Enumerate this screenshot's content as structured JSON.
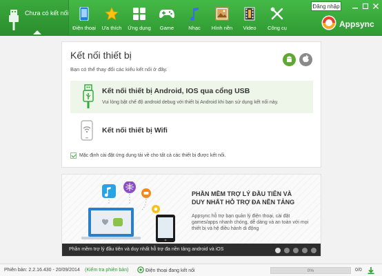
{
  "device": {
    "status_label": "Chưa có kết nối"
  },
  "nav": [
    {
      "label": "Điện thoại",
      "icon": "phone-icon"
    },
    {
      "label": "Ưa thích",
      "icon": "star-icon"
    },
    {
      "label": "Ứng dụng",
      "icon": "apps-grid-icon"
    },
    {
      "label": "Game",
      "icon": "gamepad-icon"
    },
    {
      "label": "Nhạc",
      "icon": "music-note-icon"
    },
    {
      "label": "Hình nền",
      "icon": "wallpaper-icon"
    },
    {
      "label": "Video",
      "icon": "film-icon"
    },
    {
      "label": "Công cụ",
      "icon": "tools-icon"
    }
  ],
  "header": {
    "login_label": "Đăng nhập",
    "brand": "Appsync"
  },
  "connect": {
    "title": "Kết nối thiết bị",
    "subtitle": "Bạn có thể thay đổi các kiểu kết nối ở đây.",
    "usb_title": "Kết nối thiết bị Android, IOS qua cổng USB",
    "usb_desc": "Vui lòng bật chế độ android debug với thiết bị Android khi bạn sử dụng kết nối này.",
    "wifi_title": "Kết nối thiết bị Wifi",
    "auto_install_label": "Mặc định cài đặt ứng dụng tải về cho tất cả các thiết bị được kết nối.",
    "auto_install_checked": true
  },
  "banner": {
    "heading_line1": "PHẦN MỀM TRỢ LÝ ĐẦU TIÊN VÀ",
    "heading_line2": "DUY NHẤT HỖ TRỢ ĐA NỀN TẢNG",
    "body": "Appsync hỗ trợ bạn quản lý điện thoại, cài đặt games/apps nhanh chóng, dễ dàng và an toàn với mọi thiết bị và hệ điều hành di động",
    "caption": "Phần mềm trợ lý đầu tiên và duy nhất hỗ trợ đa nền tảng android và iOS",
    "slide_count": 5,
    "active_slide": 1
  },
  "status": {
    "version": "Phiên bản: 2.2.16.430 - 20/09/2014",
    "check_update": "(Kiểm tra phiên bản)",
    "phone_status": "Điện thoại đang kết nối",
    "progress_label": "0%",
    "progress": 0,
    "count": "0/0"
  },
  "colors": {
    "accent": "#37a83a",
    "accent_dark": "#2b8d2e",
    "caption_bg": "#2e2e2e"
  }
}
